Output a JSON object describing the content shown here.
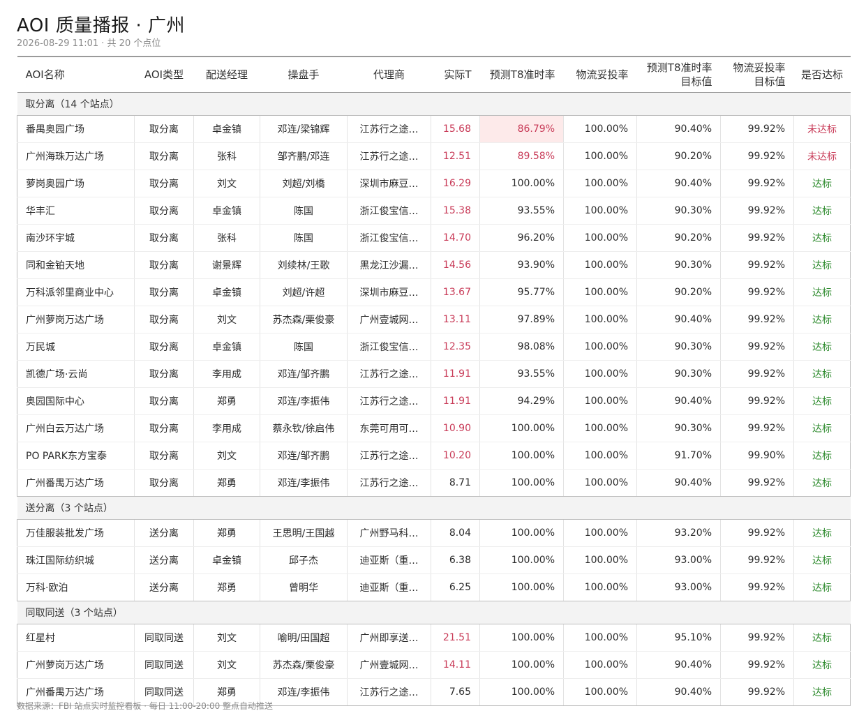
{
  "header": {
    "title": "AOI 质量播报 · 广州",
    "subtitle": "2026-08-29 11:01 · 共 20 个点位"
  },
  "columns": [
    {
      "label": "AOI名称",
      "label2": ""
    },
    {
      "label": "AOI类型",
      "label2": ""
    },
    {
      "label": "配送经理",
      "label2": ""
    },
    {
      "label": "操盘手",
      "label2": ""
    },
    {
      "label": "代理商",
      "label2": ""
    },
    {
      "label": "实际T",
      "label2": ""
    },
    {
      "label": "预测T8准时率",
      "label2": ""
    },
    {
      "label": "物流妥投率",
      "label2": ""
    },
    {
      "label": "预测T8准时率",
      "label2": "目标值"
    },
    {
      "label": "物流妥投率",
      "label2": "目标值"
    },
    {
      "label": "是否达标",
      "label2": ""
    }
  ],
  "groups": [
    {
      "label": "取分离（14 个站点）",
      "rows": [
        {
          "name": "番禺奥园广场",
          "type": "取分离",
          "manager": "卓金镇",
          "operator": "邓连/梁锦辉",
          "agent": "江苏行之途…",
          "actual_t": "15.68",
          "t_red": true,
          "t8_rate": "86.79%",
          "t8_warn": true,
          "delivery_rate": "100.00%",
          "t8_target": "90.40%",
          "delivery_target": "99.92%",
          "status": "未达标",
          "ok": false
        },
        {
          "name": "广州海珠万达广场",
          "type": "取分离",
          "manager": "张科",
          "operator": "邹齐鹏/邓连",
          "agent": "江苏行之途…",
          "actual_t": "12.51",
          "t_red": true,
          "t8_rate": "89.58%",
          "t8_warn": "text",
          "delivery_rate": "100.00%",
          "t8_target": "90.20%",
          "delivery_target": "99.92%",
          "status": "未达标",
          "ok": false
        },
        {
          "name": "萝岗奥园广场",
          "type": "取分离",
          "manager": "刘文",
          "operator": "刘超/刘橋",
          "agent": "深圳市麻豆…",
          "actual_t": "16.29",
          "t_red": true,
          "t8_rate": "100.00%",
          "t8_warn": false,
          "delivery_rate": "100.00%",
          "t8_target": "90.40%",
          "delivery_target": "99.92%",
          "status": "达标",
          "ok": true
        },
        {
          "name": "华丰汇",
          "type": "取分离",
          "manager": "卓金镇",
          "operator": "陈国",
          "agent": "浙江俊宝信…",
          "actual_t": "15.38",
          "t_red": true,
          "t8_rate": "93.55%",
          "t8_warn": false,
          "delivery_rate": "100.00%",
          "t8_target": "90.30%",
          "delivery_target": "99.92%",
          "status": "达标",
          "ok": true
        },
        {
          "name": "南沙环宇城",
          "type": "取分离",
          "manager": "张科",
          "operator": "陈国",
          "agent": "浙江俊宝信…",
          "actual_t": "14.70",
          "t_red": true,
          "t8_rate": "96.20%",
          "t8_warn": false,
          "delivery_rate": "100.00%",
          "t8_target": "90.20%",
          "delivery_target": "99.92%",
          "status": "达标",
          "ok": true
        },
        {
          "name": "同和金铂天地",
          "type": "取分离",
          "manager": "谢景辉",
          "operator": "刘续林/王歌",
          "agent": "黑龙江沙漏…",
          "actual_t": "14.56",
          "t_red": true,
          "t8_rate": "93.90%",
          "t8_warn": false,
          "delivery_rate": "100.00%",
          "t8_target": "90.30%",
          "delivery_target": "99.92%",
          "status": "达标",
          "ok": true
        },
        {
          "name": "万科派邻里商业中心",
          "type": "取分离",
          "manager": "卓金镇",
          "operator": "刘超/许超",
          "agent": "深圳市麻豆…",
          "actual_t": "13.67",
          "t_red": true,
          "t8_rate": "95.77%",
          "t8_warn": false,
          "delivery_rate": "100.00%",
          "t8_target": "90.20%",
          "delivery_target": "99.92%",
          "status": "达标",
          "ok": true
        },
        {
          "name": "广州萝岗万达广场",
          "type": "取分离",
          "manager": "刘文",
          "operator": "苏杰森/栗俊豪",
          "agent": "广州壹城网…",
          "actual_t": "13.11",
          "t_red": true,
          "t8_rate": "97.89%",
          "t8_warn": false,
          "delivery_rate": "100.00%",
          "t8_target": "90.40%",
          "delivery_target": "99.92%",
          "status": "达标",
          "ok": true
        },
        {
          "name": "万民城",
          "type": "取分离",
          "manager": "卓金镇",
          "operator": "陈国",
          "agent": "浙江俊宝信…",
          "actual_t": "12.35",
          "t_red": true,
          "t8_rate": "98.08%",
          "t8_warn": false,
          "delivery_rate": "100.00%",
          "t8_target": "90.30%",
          "delivery_target": "99.92%",
          "status": "达标",
          "ok": true
        },
        {
          "name": "凯德广场·云尚",
          "type": "取分离",
          "manager": "李用成",
          "operator": "邓连/邹齐鹏",
          "agent": "江苏行之途…",
          "actual_t": "11.91",
          "t_red": true,
          "t8_rate": "93.55%",
          "t8_warn": false,
          "delivery_rate": "100.00%",
          "t8_target": "90.30%",
          "delivery_target": "99.92%",
          "status": "达标",
          "ok": true
        },
        {
          "name": "奥园国际中心",
          "type": "取分离",
          "manager": "郑勇",
          "operator": "邓连/李振伟",
          "agent": "江苏行之途…",
          "actual_t": "11.91",
          "t_red": true,
          "t8_rate": "94.29%",
          "t8_warn": false,
          "delivery_rate": "100.00%",
          "t8_target": "90.40%",
          "delivery_target": "99.92%",
          "status": "达标",
          "ok": true
        },
        {
          "name": "广州白云万达广场",
          "type": "取分离",
          "manager": "李用成",
          "operator": "蔡永钦/徐启伟",
          "agent": "东莞可用可…",
          "actual_t": "10.90",
          "t_red": true,
          "t8_rate": "100.00%",
          "t8_warn": false,
          "delivery_rate": "100.00%",
          "t8_target": "90.30%",
          "delivery_target": "99.92%",
          "status": "达标",
          "ok": true
        },
        {
          "name": "PO PARK东方宝泰",
          "type": "取分离",
          "manager": "刘文",
          "operator": "邓连/邹齐鹏",
          "agent": "江苏行之途…",
          "actual_t": "10.20",
          "t_red": true,
          "t8_rate": "100.00%",
          "t8_warn": false,
          "delivery_rate": "100.00%",
          "t8_target": "91.70%",
          "delivery_target": "99.90%",
          "status": "达标",
          "ok": true
        },
        {
          "name": "广州番禺万达广场",
          "type": "取分离",
          "manager": "郑勇",
          "operator": "邓连/李振伟",
          "agent": "江苏行之途…",
          "actual_t": "8.71",
          "t_red": false,
          "t8_rate": "100.00%",
          "t8_warn": false,
          "delivery_rate": "100.00%",
          "t8_target": "90.40%",
          "delivery_target": "99.92%",
          "status": "达标",
          "ok": true
        }
      ]
    },
    {
      "label": "送分离（3 个站点）",
      "rows": [
        {
          "name": "万佳服装批发广场",
          "type": "送分离",
          "manager": "郑勇",
          "operator": "王思明/王国越",
          "agent": "广州野马科…",
          "actual_t": "8.04",
          "t_red": false,
          "t8_rate": "100.00%",
          "t8_warn": false,
          "delivery_rate": "100.00%",
          "t8_target": "93.20%",
          "delivery_target": "99.92%",
          "status": "达标",
          "ok": true
        },
        {
          "name": "珠江国际纺织城",
          "type": "送分离",
          "manager": "卓金镇",
          "operator": "邱子杰",
          "agent": "迪亚斯（重…",
          "actual_t": "6.38",
          "t_red": false,
          "t8_rate": "100.00%",
          "t8_warn": false,
          "delivery_rate": "100.00%",
          "t8_target": "93.00%",
          "delivery_target": "99.92%",
          "status": "达标",
          "ok": true
        },
        {
          "name": "万科·欧泊",
          "type": "送分离",
          "manager": "郑勇",
          "operator": "曾明华",
          "agent": "迪亚斯（重…",
          "actual_t": "6.25",
          "t_red": false,
          "t8_rate": "100.00%",
          "t8_warn": false,
          "delivery_rate": "100.00%",
          "t8_target": "93.00%",
          "delivery_target": "99.92%",
          "status": "达标",
          "ok": true
        }
      ]
    },
    {
      "label": "同取同送（3 个站点）",
      "rows": [
        {
          "name": "红星村",
          "type": "同取同送",
          "manager": "刘文",
          "operator": "喻明/田国超",
          "agent": "广州即享送…",
          "actual_t": "21.51",
          "t_red": true,
          "t8_rate": "100.00%",
          "t8_warn": false,
          "delivery_rate": "100.00%",
          "t8_target": "95.10%",
          "delivery_target": "99.92%",
          "status": "达标",
          "ok": true
        },
        {
          "name": "广州萝岗万达广场",
          "type": "同取同送",
          "manager": "刘文",
          "operator": "苏杰森/栗俊豪",
          "agent": "广州壹城网…",
          "actual_t": "14.11",
          "t_red": true,
          "t8_rate": "100.00%",
          "t8_warn": false,
          "delivery_rate": "100.00%",
          "t8_target": "90.40%",
          "delivery_target": "99.92%",
          "status": "达标",
          "ok": true
        },
        {
          "name": "广州番禺万达广场",
          "type": "同取同送",
          "manager": "郑勇",
          "operator": "邓连/李振伟",
          "agent": "江苏行之途…",
          "actual_t": "7.65",
          "t_red": false,
          "t8_rate": "100.00%",
          "t8_warn": false,
          "delivery_rate": "100.00%",
          "t8_target": "90.40%",
          "delivery_target": "99.92%",
          "status": "达标",
          "ok": true
        }
      ]
    }
  ],
  "footer": {
    "text": "数据来源：FBI 站点实时监控看板 · 每日 11:00-20:00 整点自动推送"
  },
  "colors": {
    "alert_red": "#c83a57",
    "ok_green": "#2e8b2e",
    "warn_bg": "#fdeaea",
    "group_bg": "#f3f3f3"
  }
}
